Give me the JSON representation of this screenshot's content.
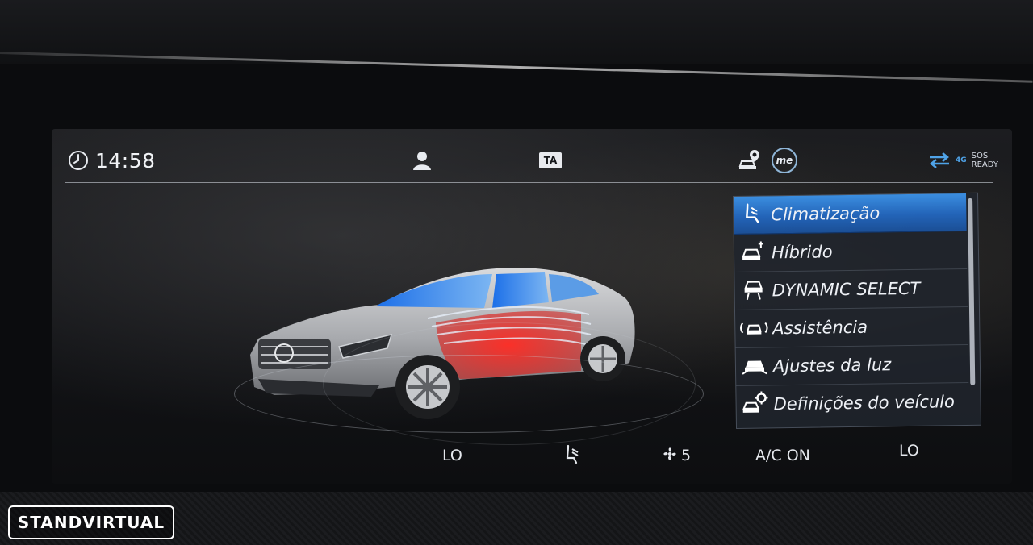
{
  "status_bar": {
    "time": "14:58",
    "ta_label": "TA",
    "me_label": "me",
    "sos_line1": "SOS",
    "sos_line2": "READY",
    "network": "4G"
  },
  "menu": {
    "items": [
      {
        "label": "Climatização",
        "icon": "climate-seat-icon",
        "active": true
      },
      {
        "label": "Híbrido",
        "icon": "hybrid-car-plug-icon",
        "active": false
      },
      {
        "label": "DYNAMIC SELECT",
        "icon": "dynamic-select-car-icon",
        "active": false
      },
      {
        "label": "Assistência",
        "icon": "assist-car-waves-icon",
        "active": false
      },
      {
        "label": "Ajustes da luz",
        "icon": "headlight-car-icon",
        "active": false
      },
      {
        "label": "Definições do veículo",
        "icon": "vehicle-settings-gear-icon",
        "active": false
      }
    ]
  },
  "climate": {
    "left_temp": "LO",
    "fan_level": "5",
    "ac_status": "A/C ON",
    "right_temp": "LO"
  },
  "watermark": {
    "text": "STANDVIRTUAL"
  },
  "colors": {
    "active_blue": "#2f7fd6",
    "airflow_warm": "#e0231f",
    "airflow_cool": "#3f7fe0"
  }
}
